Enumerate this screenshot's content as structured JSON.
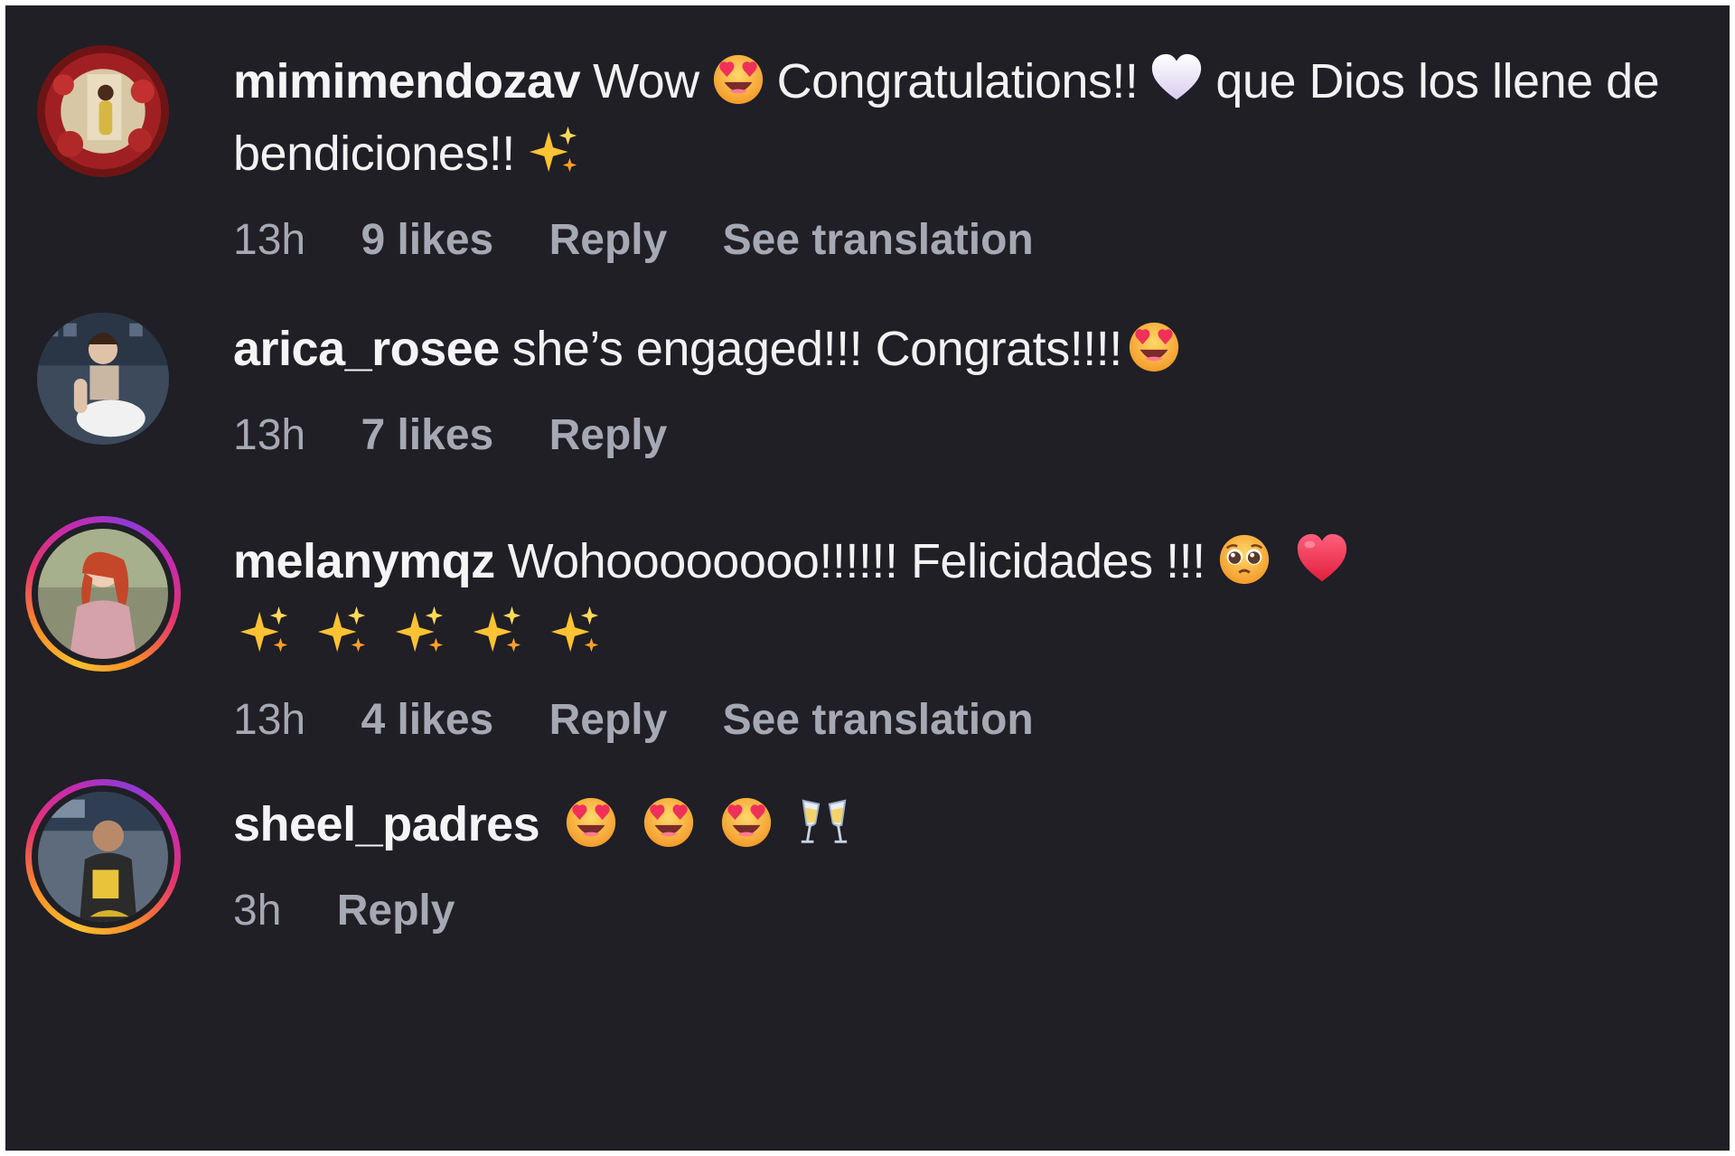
{
  "comments": [
    {
      "username": "mimimendozav",
      "segments": [
        "Wow",
        "Congratulations!!",
        "que Dios los llene de bendiciones!!"
      ],
      "emojis": [
        "heart-eyes-emoji",
        "white-heart-emoji",
        "sparkles-emoji"
      ],
      "time": "13h",
      "likes": "9 likes",
      "reply": "Reply",
      "translation": "See translation"
    },
    {
      "username": "arica_rosee",
      "segments": [
        "she’s engaged!!! Congrats!!!!"
      ],
      "emojis": [
        "heart-eyes-emoji"
      ],
      "time": "13h",
      "likes": "7 likes",
      "reply": "Reply"
    },
    {
      "username": "melanymqz",
      "segments": [
        "Wohoooooooo!!!!!! Felicidades !!!"
      ],
      "emojis": [
        "pleading-face-emoji",
        "red-heart-emoji",
        "sparkles-emoji",
        "sparkles-emoji",
        "sparkles-emoji",
        "sparkles-emoji",
        "sparkles-emoji"
      ],
      "time": "13h",
      "likes": "4 likes",
      "reply": "Reply",
      "translation": "See translation"
    },
    {
      "username": "sheel_padres",
      "segments": [],
      "emojis": [
        "heart-eyes-emoji",
        "heart-eyes-emoji",
        "heart-eyes-emoji",
        "clinking-glasses-emoji"
      ],
      "time": "3h",
      "reply": "Reply"
    }
  ],
  "colors": {
    "background": "#1f1f25",
    "text": "#f2f2f4",
    "meta": "#a6a8b4"
  }
}
